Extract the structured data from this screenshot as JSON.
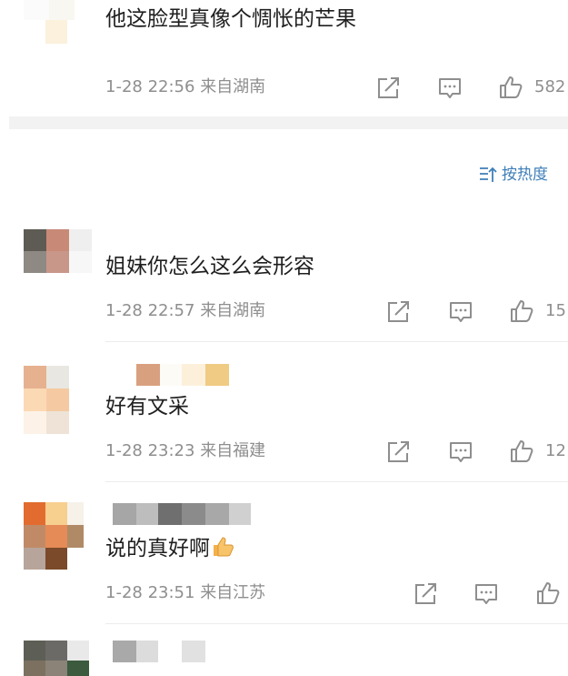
{
  "sort": {
    "label": "按热度",
    "icon": "sort-icon",
    "color": "#3f7fb8"
  },
  "comments": [
    {
      "text": "他这脸型真像个惆怅的芒果",
      "time": "1-28 22:56",
      "location": "来自湖南",
      "likes": "582"
    },
    {
      "text": "姐妹你怎么这么会形容",
      "time": "1-28 22:57",
      "location": "来自湖南",
      "likes": "15"
    },
    {
      "text": "好有文采",
      "time": "1-28 23:23",
      "location": "来自福建",
      "likes": "12"
    },
    {
      "text": "说的真好啊",
      "emoji": "thumbs-up-emoji",
      "time": "1-28 23:51",
      "location": "来自江苏",
      "likes": ""
    }
  ],
  "icons": {
    "share": "share-icon",
    "reply": "reply-icon",
    "like": "like-icon"
  },
  "colors": {
    "meta": "#8e8e8e",
    "divider": "#ececec",
    "section_gap": "#f2f2f2"
  }
}
